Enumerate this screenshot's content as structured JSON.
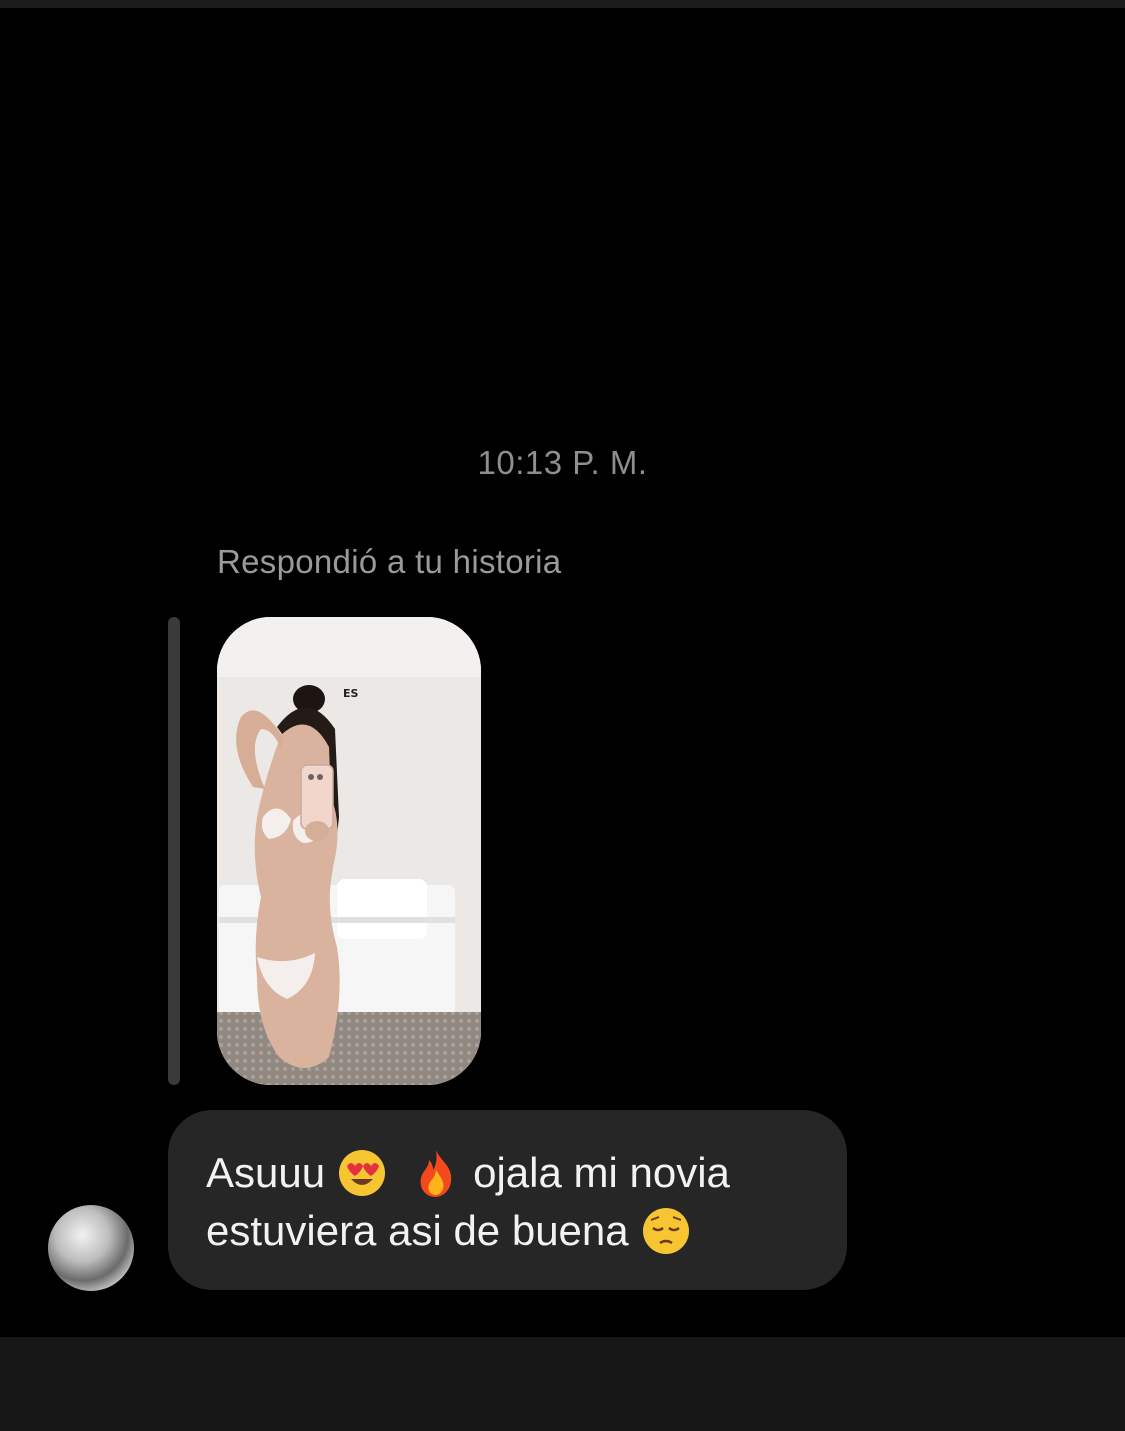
{
  "timestamp": "10:13 P. M.",
  "reply_note": "Respondió a tu historia",
  "story_preview": {
    "badge": "ES"
  },
  "message": {
    "line1_before": "Asuuu",
    "line1_after": "ojala mi novia",
    "line2": "estuviera asi de buena",
    "emojis": [
      "heart-eyes-emoji",
      "fire-emoji",
      "pensive-emoji"
    ]
  },
  "colors": {
    "background": "#000000",
    "bubble": "#262626",
    "muted_text": "#8e8e8e"
  }
}
